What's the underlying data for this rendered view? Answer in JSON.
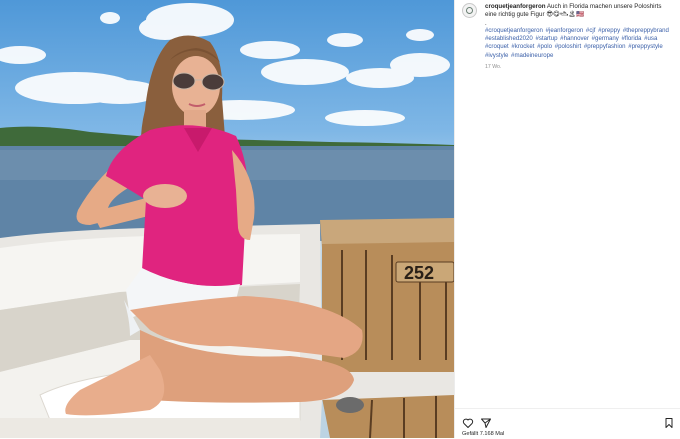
{
  "post": {
    "username": "croquetjeanforgeron",
    "caption": "Auch in Florida machen unsere Poloshirts eine richtig gute Figur",
    "caption_emojis": "😎😋🛥🏝🇺🇸",
    "separator": ".",
    "hashtags": "#croquetjeanforgeron #jeanforgeron #cjf #preppy #thepreppybrand #established2020 #startup #hannover #germany #florida #usa #croquet #krocket #polo #poloshirt #preppyfashion #preppystyle #ivystyle #madeineurope",
    "timestamp": "17 Wo.",
    "likes_text": "Gefällt 7.168 Mal"
  },
  "photo": {
    "boat_number": "252"
  },
  "icons": {
    "avatar": "brand-logo-avatar",
    "like": "heart-icon",
    "share": "paper-plane-icon",
    "save": "bookmark-icon"
  },
  "colors": {
    "hashtag": "#3a5fa8",
    "text": "#262626",
    "muted": "#8e8e8e",
    "polo_shirt": "#e0247f"
  }
}
